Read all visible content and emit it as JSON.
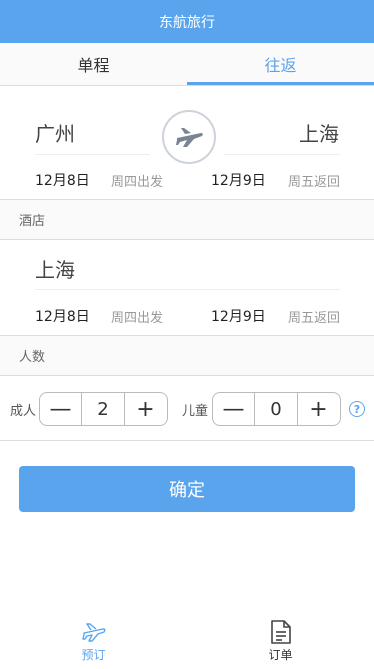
{
  "header": {
    "title": "东航旅行"
  },
  "tabs": [
    {
      "label": "单程"
    },
    {
      "label": "往返"
    }
  ],
  "flight": {
    "from_city": "广州",
    "to_city": "上海",
    "depart_date": "12月8日",
    "depart_weekday": "周四出发",
    "return_date": "12月9日",
    "return_weekday": "周五返回"
  },
  "hotel": {
    "label": "酒店",
    "city": "上海",
    "checkin_date": "12月8日",
    "checkin_weekday": "周四出发",
    "checkout_date": "12月9日",
    "checkout_weekday": "周五返回"
  },
  "passengers": {
    "label": "人数",
    "adult_label": "成人",
    "adult_count": "2",
    "child_label": "儿童",
    "child_count": "0",
    "minus": "—",
    "plus": "+",
    "help": "?"
  },
  "confirm_label": "确定",
  "bottom_nav": [
    {
      "label": "预订",
      "icon": "plane-icon"
    },
    {
      "label": "订单",
      "icon": "document-icon"
    }
  ],
  "colors": {
    "accent": "#5aa4ee"
  }
}
